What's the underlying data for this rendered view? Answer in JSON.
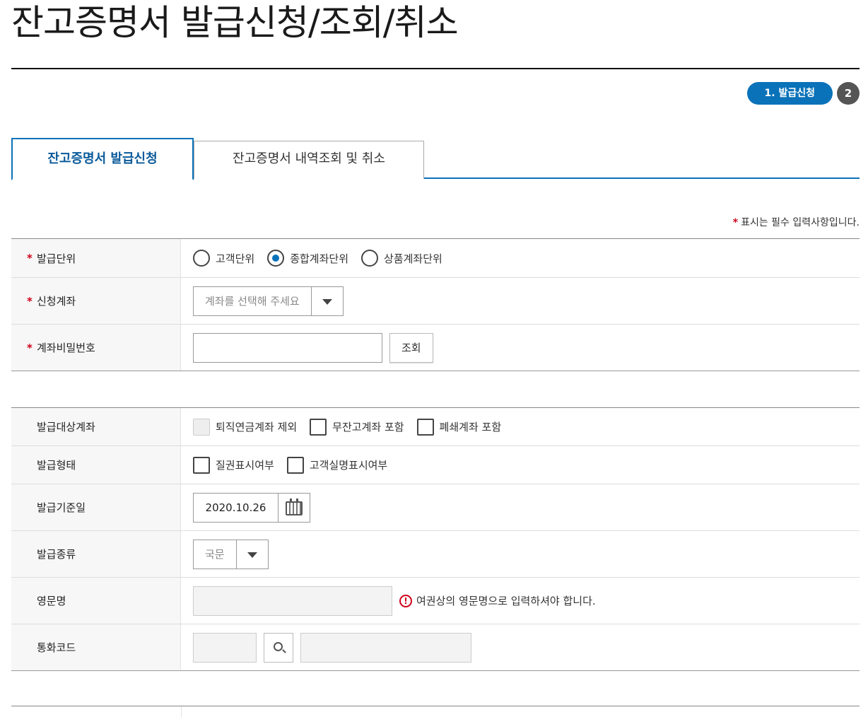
{
  "page": {
    "title": "잔고증명서 발급신청/조회/취소"
  },
  "steps": {
    "active_label": "1. 발급신청",
    "next_label": "2"
  },
  "tabs": [
    {
      "label": "잔고증명서 발급신청"
    },
    {
      "label": "잔고증명서 내역조회 및 취소"
    }
  ],
  "required_note": {
    "star": "*",
    "text": "표시는 필수 입력사항입니다."
  },
  "section1": {
    "issue_unit": {
      "label": "발급단위",
      "options": [
        "고객단위",
        "종합계좌단위",
        "상품계좌단위"
      ],
      "selected_index": 1
    },
    "account": {
      "label": "신청계좌",
      "placeholder": "계좌를 선택해 주세요"
    },
    "password": {
      "label": "계좌비밀번호",
      "value": "",
      "button_label": "조회"
    }
  },
  "section2": {
    "target_accounts": {
      "label": "발급대상계좌",
      "options": [
        {
          "text": "퇴직연금계좌 제외",
          "checked": false,
          "disabled": true
        },
        {
          "text": "무잔고계좌 포함",
          "checked": false,
          "disabled": false
        },
        {
          "text": "폐쇄계좌 포함",
          "checked": false,
          "disabled": false
        }
      ]
    },
    "issue_form": {
      "label": "발급형태",
      "options": [
        {
          "text": "질권표시여부",
          "checked": false
        },
        {
          "text": "고객실명표시여부",
          "checked": false
        }
      ]
    },
    "base_date": {
      "label": "발급기준일",
      "value": "2020.10.26"
    },
    "issue_type": {
      "label": "발급종류",
      "value": "국문"
    },
    "english_name": {
      "label": "영문명",
      "value": "",
      "notice": "여권상의 영문명으로 입력하셔야 합니다."
    },
    "currency": {
      "label": "통화코드",
      "code": "",
      "name": ""
    }
  },
  "icons": {
    "dropdown": "chevron-down-icon",
    "calendar": "calendar-icon",
    "search": "search-icon",
    "warning": "exclamation-circle-icon"
  },
  "colors": {
    "accent": "#0a72b9",
    "required": "#d0021b",
    "step_inactive": "#555555"
  }
}
